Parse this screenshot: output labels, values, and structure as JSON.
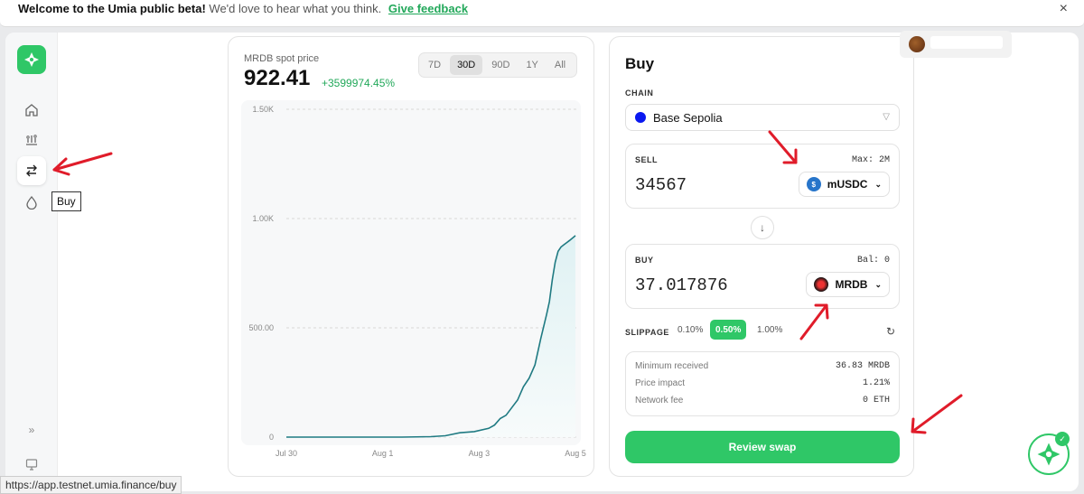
{
  "banner": {
    "bold_text": "Welcome to the Umia public beta!",
    "sub_text": "We'd love to hear what you think.",
    "link": "Give feedback",
    "close": "×"
  },
  "sidebar": {
    "tooltip": "Buy",
    "icons": [
      "home-icon",
      "portfolio-icon",
      "swap-icon",
      "drop-icon",
      "expand-icon",
      "monitor-icon"
    ],
    "expand": "»"
  },
  "chart_panel": {
    "label": "MRDB spot price",
    "price": "922.41",
    "change": "+3599974.45%",
    "ranges": [
      "7D",
      "30D",
      "90D",
      "1Y",
      "All"
    ],
    "active_range": "30D"
  },
  "chart_data": {
    "type": "area",
    "ylim": [
      0,
      1500
    ],
    "y_ticks": [
      "0",
      "500.00",
      "1.00K",
      "1.50K"
    ],
    "x_ticks": [
      "Jul 30",
      "Aug 1",
      "Aug 3",
      "Aug 5"
    ],
    "x": [
      0,
      0.2,
      0.4,
      0.5,
      0.55,
      0.6,
      0.65,
      0.7,
      0.72,
      0.74,
      0.76,
      0.78,
      0.8,
      0.82,
      0.84,
      0.86,
      0.88,
      0.9,
      0.91,
      0.92,
      0.93,
      0.94,
      0.95,
      0.96,
      0.97,
      0.98,
      1.0
    ],
    "y": [
      0,
      0,
      0,
      2,
      6,
      20,
      25,
      40,
      55,
      85,
      100,
      135,
      170,
      230,
      270,
      330,
      450,
      560,
      620,
      720,
      800,
      850,
      870,
      880,
      890,
      900,
      922
    ],
    "line_color": "#1f7a82"
  },
  "buy": {
    "title": "Buy",
    "chain_label": "CHAIN",
    "chain_value": "Base Sepolia",
    "sell": {
      "label": "SELL",
      "right": "Max: 2M",
      "amount": "34567",
      "token": "mUSDC"
    },
    "receive": {
      "label": "BUY",
      "right": "Bal: 0",
      "amount": "37.017876",
      "token": "MRDB"
    },
    "slippage": {
      "label": "SLIPPAGE",
      "options": [
        "0.10%",
        "0.50%",
        "1.00%"
      ],
      "active": "0.50%"
    },
    "summary": [
      {
        "k": "Minimum received",
        "v": "36.83 MRDB"
      },
      {
        "k": "Price impact",
        "v": "1.21%"
      },
      {
        "k": "Network fee",
        "v": "0 ETH"
      }
    ],
    "review_button": "Review swap"
  },
  "status_url": "https://app.testnet.umia.finance/buy",
  "colors": {
    "accent": "#2fc767",
    "change_green": "#22a85a",
    "annotation_red": "#e01c2a",
    "chain_blue": "#0a18f0"
  }
}
